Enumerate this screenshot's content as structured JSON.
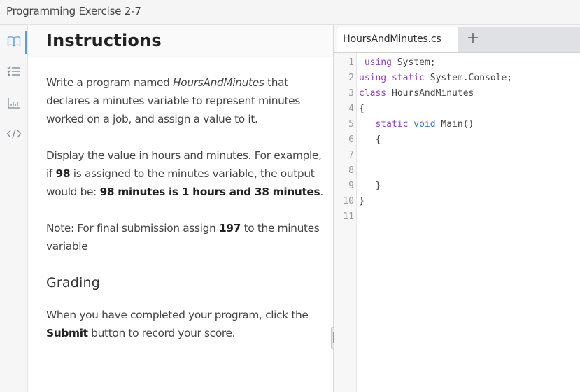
{
  "window": {
    "title": "Programming Exercise 2-7"
  },
  "icon_rail": {
    "items": [
      {
        "icon": "book-icon",
        "label": "Instructions",
        "active": true
      },
      {
        "icon": "checklist-icon",
        "label": "Tasks",
        "active": false
      },
      {
        "icon": "bar-chart-icon",
        "label": "Results",
        "active": false
      },
      {
        "icon": "code-icon",
        "label": "Code",
        "active": false
      }
    ],
    "accent_color": "#5a9fd4"
  },
  "instructions": {
    "heading": "Instructions",
    "p1": {
      "pre": "Write a program named ",
      "italic": "HoursAndMinutes",
      "post": " that declares a minutes variable to represent minutes worked on a job, and assign a value to it."
    },
    "p2": {
      "pre": "Display the value in hours and minutes. For example, if ",
      "bold1": "98",
      "mid": " is assigned to the minutes variable, the output would be: ",
      "bold2": "98 minutes is 1 hours and 38 minutes",
      "post": "."
    },
    "p3": {
      "pre": "Note: For final submission assign ",
      "bold": "197",
      "post": " to the minutes variable"
    },
    "grading_heading": "Grading",
    "p4": {
      "pre": "When you have completed your program, click the ",
      "bold": "Submit",
      "post": " button to record your score."
    }
  },
  "editor": {
    "tabs": [
      {
        "label": "HoursAndMinutes.cs",
        "active": true
      }
    ],
    "add_tab_icon": "plus-icon",
    "lines": [
      {
        "n": "1",
        "tokens": [
          {
            "t": " "
          },
          {
            "t": "using",
            "k": "kw"
          },
          {
            "t": " System;"
          }
        ]
      },
      {
        "n": "2",
        "tokens": [
          {
            "t": "using",
            "k": "kw"
          },
          {
            "t": " "
          },
          {
            "t": "static",
            "k": "kw"
          },
          {
            "t": " System.Console;"
          }
        ]
      },
      {
        "n": "3",
        "tokens": [
          {
            "t": "class",
            "k": "kw"
          },
          {
            "t": " HoursAndMinutes"
          }
        ]
      },
      {
        "n": "4",
        "tokens": [
          {
            "t": "{"
          }
        ]
      },
      {
        "n": "5",
        "tokens": [
          {
            "t": "   "
          },
          {
            "t": "static",
            "k": "kw"
          },
          {
            "t": " "
          },
          {
            "t": "void",
            "k": "kw2"
          },
          {
            "t": " Main()"
          }
        ]
      },
      {
        "n": "6",
        "tokens": [
          {
            "t": "   {"
          }
        ]
      },
      {
        "n": "7",
        "tokens": []
      },
      {
        "n": "8",
        "tokens": []
      },
      {
        "n": "9",
        "tokens": [
          {
            "t": "   }"
          }
        ]
      },
      {
        "n": "10",
        "tokens": [
          {
            "t": "}"
          }
        ]
      },
      {
        "n": "11",
        "tokens": []
      }
    ],
    "colors": {
      "keyword": "#8b47b5",
      "type_keyword": "#2f72c4"
    }
  }
}
